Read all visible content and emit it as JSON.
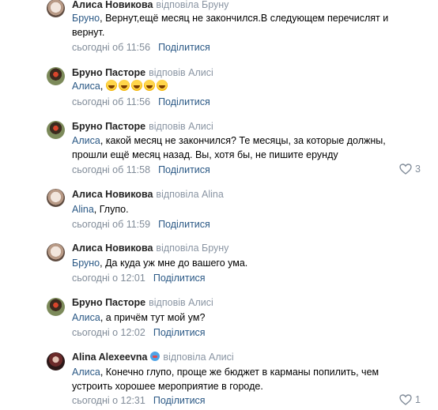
{
  "comments": [
    {
      "author": "Алиса Новикова",
      "reply_text": "відповіла Бруну",
      "mention": "Бруно",
      "text": ", Вернут,ещё месяц не закончился.В следующем перечислят и вернут.",
      "time": "сьогодні об 11:56",
      "share": "Поділитися",
      "avatar_icon": "user-avatar-icon"
    },
    {
      "author": "Бруно Пасторе",
      "reply_text": "відповів Алисі",
      "mention": "Алиса",
      "text": ",",
      "emoji_count": 5,
      "emoji_icon": "rolling-laughing-emoji-icon",
      "time": "сьогодні об 11:56",
      "share": "Поділитися",
      "avatar_icon": "user-avatar-icon"
    },
    {
      "author": "Бруно Пасторе",
      "reply_text": "відповів Алисі",
      "mention": "Алиса",
      "text": ", какой месяц не закончился? Те месяцы, за которые должны, прошли ещё месяц назад. Вы, хотя бы, не пишите ерунду",
      "time": "сьогодні об 11:58",
      "share": "Поділитися",
      "likes": "3",
      "avatar_icon": "user-avatar-icon"
    },
    {
      "author": "Алиса Новикова",
      "reply_text": "відповіла Alina",
      "mention": "Alina",
      "text": ", Глупо.",
      "time": "сьогодні об 11:59",
      "share": "Поділитися",
      "avatar_icon": "user-avatar-icon"
    },
    {
      "author": "Алиса Новикова",
      "reply_text": "відповіла Бруну",
      "mention": "Бруно",
      "text": ", Да куда уж мне до вашего ума.",
      "time": "сьогодні о 12:01",
      "share": "Поділитися",
      "avatar_icon": "user-avatar-icon"
    },
    {
      "author": "Бруно Пасторе",
      "reply_text": "відповів Алисі",
      "mention": "Алиса",
      "text": ", а причём тут мой ум?",
      "time": "сьогодні о 12:02",
      "share": "Поділитися",
      "avatar_icon": "user-avatar-icon"
    },
    {
      "author": "Alina Alexeevna",
      "reply_text": "відповіла Алисі",
      "mention": "Алиса",
      "text": ", Конечно глупо, проще же бюджет в карманы попилить, чем устроить хорошее мероприятие в городе.",
      "time": "сьогодні о 12:31",
      "share": "Поділитися",
      "likes": "1",
      "avatar_icon": "user-avatar-icon",
      "badge_icon": "captain-america-shield-icon"
    }
  ],
  "colors": {
    "link": "#2a5885",
    "meta": "#818c99",
    "reply": "#8a95a3"
  }
}
